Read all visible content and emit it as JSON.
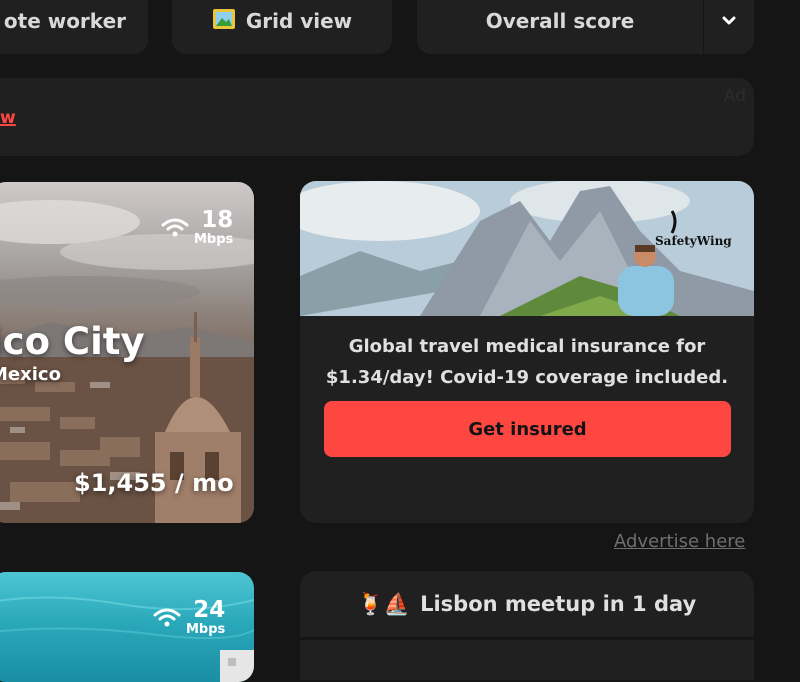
{
  "filters": {
    "filter1_label": "ote worker",
    "filter2_icon": "picture-icon",
    "filter2_label": "Grid view",
    "sort_label": "Overall score",
    "sort_icon": "chevron-down-icon"
  },
  "ad_bar": {
    "link_text": "w",
    "tag": "Ad"
  },
  "cities": [
    {
      "name": "ico City",
      "country": "Mexico",
      "wifi_speed": "18",
      "wifi_unit": "Mbps",
      "price": "$1,455 / mo"
    },
    {
      "wifi_speed": "24",
      "wifi_unit": "Mbps"
    }
  ],
  "sponsor": {
    "brand": "SafetyWing",
    "text_line1": "Global travel medical insurance for",
    "text_line2": "$1.34/day! Covid-19 coverage included.",
    "button_label": "Get insured"
  },
  "advertise_link": "Advertise here",
  "meetup": {
    "emoji": "🍹⛵",
    "label": "Lisbon meetup in 1 day"
  },
  "colors": {
    "background": "#151515",
    "card": "#202020",
    "accent": "#ff4742"
  }
}
